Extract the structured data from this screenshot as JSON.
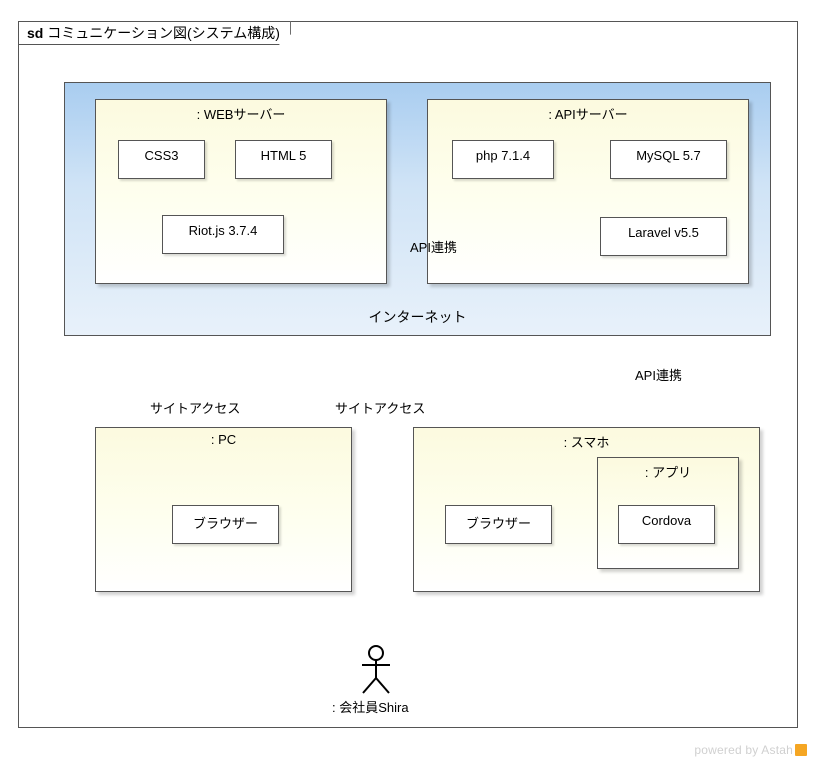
{
  "diagram": {
    "sd_prefix": "sd",
    "title": "コミュニケーション図(システム構成)"
  },
  "regions": {
    "internet": "インターネット"
  },
  "lifelines": {
    "web_server": ": WEBサーバー",
    "api_server": ": APIサーバー",
    "pc": ": PC",
    "smartphone": ": スマホ",
    "app": ": アプリ"
  },
  "components": {
    "css3": "CSS3",
    "html5": "HTML 5",
    "riotjs": "Riot.js 3.7.4",
    "php": "php 7.1.4",
    "mysql": "MySQL 5.7",
    "laravel": "Laravel v5.5",
    "pc_browser": "ブラウザー",
    "sp_browser": "ブラウザー",
    "cordova": "Cordova"
  },
  "messages": {
    "api_link_1": "API連携",
    "api_link_2": "API連携",
    "site_access_1": "サイトアクセス",
    "site_access_2": "サイトアクセス"
  },
  "actor": {
    "name": ": 会社員Shira"
  },
  "watermark": {
    "text": "powered by Astah"
  }
}
